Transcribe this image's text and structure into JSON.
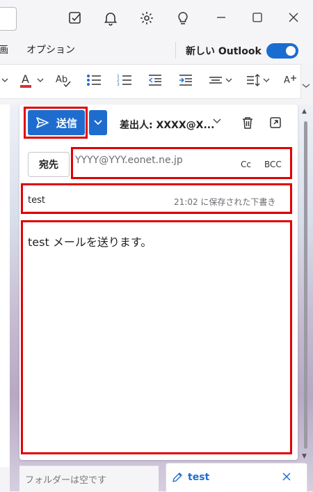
{
  "menu": {
    "item_partial": "画",
    "options": "オプション",
    "new_outlook": "新しい Outlook"
  },
  "compose": {
    "send_label": "送信",
    "from_label": "差出人: XXXX@X...",
    "to_button": "宛先",
    "to_value": "YYYY@YYY.eonet.ne.jp",
    "cc": "Cc",
    "bcc": "BCC",
    "subject": "test",
    "saved_note": "21:02 に保存された下書き",
    "body": "test メールを送ります。"
  },
  "bottom": {
    "folder_empty": "フォルダーは空です",
    "draft_tab_label": "test"
  },
  "colors": {
    "accent": "#1f6ccf",
    "highlight": "#e00000"
  }
}
